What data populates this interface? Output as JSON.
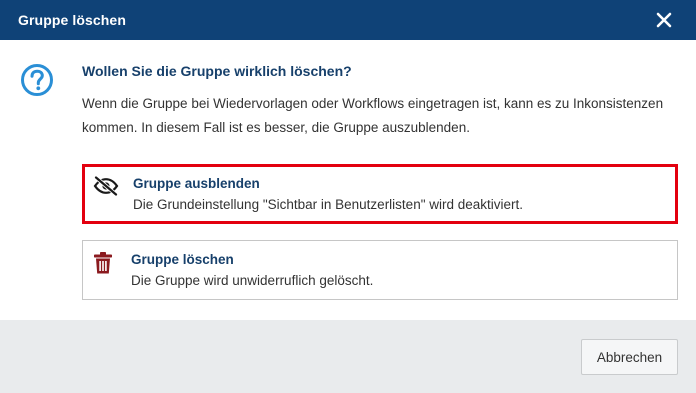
{
  "dialog": {
    "title": "Gruppe löschen",
    "close_icon": "close-icon",
    "question_icon": "question-circle-icon",
    "heading": "Wollen Sie die Gruppe wirklich löschen?",
    "message": "Wenn die Gruppe bei Wiedervorlagen oder Workflows eingetragen ist, kann es zu Inkonsistenzen kommen. In diesem Fall ist es besser, die Gruppe auszublenden."
  },
  "options": [
    {
      "icon": "eye-slash-icon",
      "title": "Gruppe ausblenden",
      "description": "Die Grundeinstellung \"Sichtbar in Benutzerlisten\" wird deaktiviert.",
      "highlighted": true
    },
    {
      "icon": "trash-icon",
      "title": "Gruppe löschen",
      "description": "Die Gruppe wird unwiderruflich gelöscht.",
      "highlighted": false
    }
  ],
  "footer": {
    "cancel_label": "Abbrechen"
  },
  "colors": {
    "titlebar": "#0f4277",
    "accent_blue": "#2a8fd6",
    "heading_text": "#17406b",
    "highlight_border": "#e3000f",
    "trash_icon": "#8b1a1f",
    "footer_bg": "#e9ebed"
  }
}
